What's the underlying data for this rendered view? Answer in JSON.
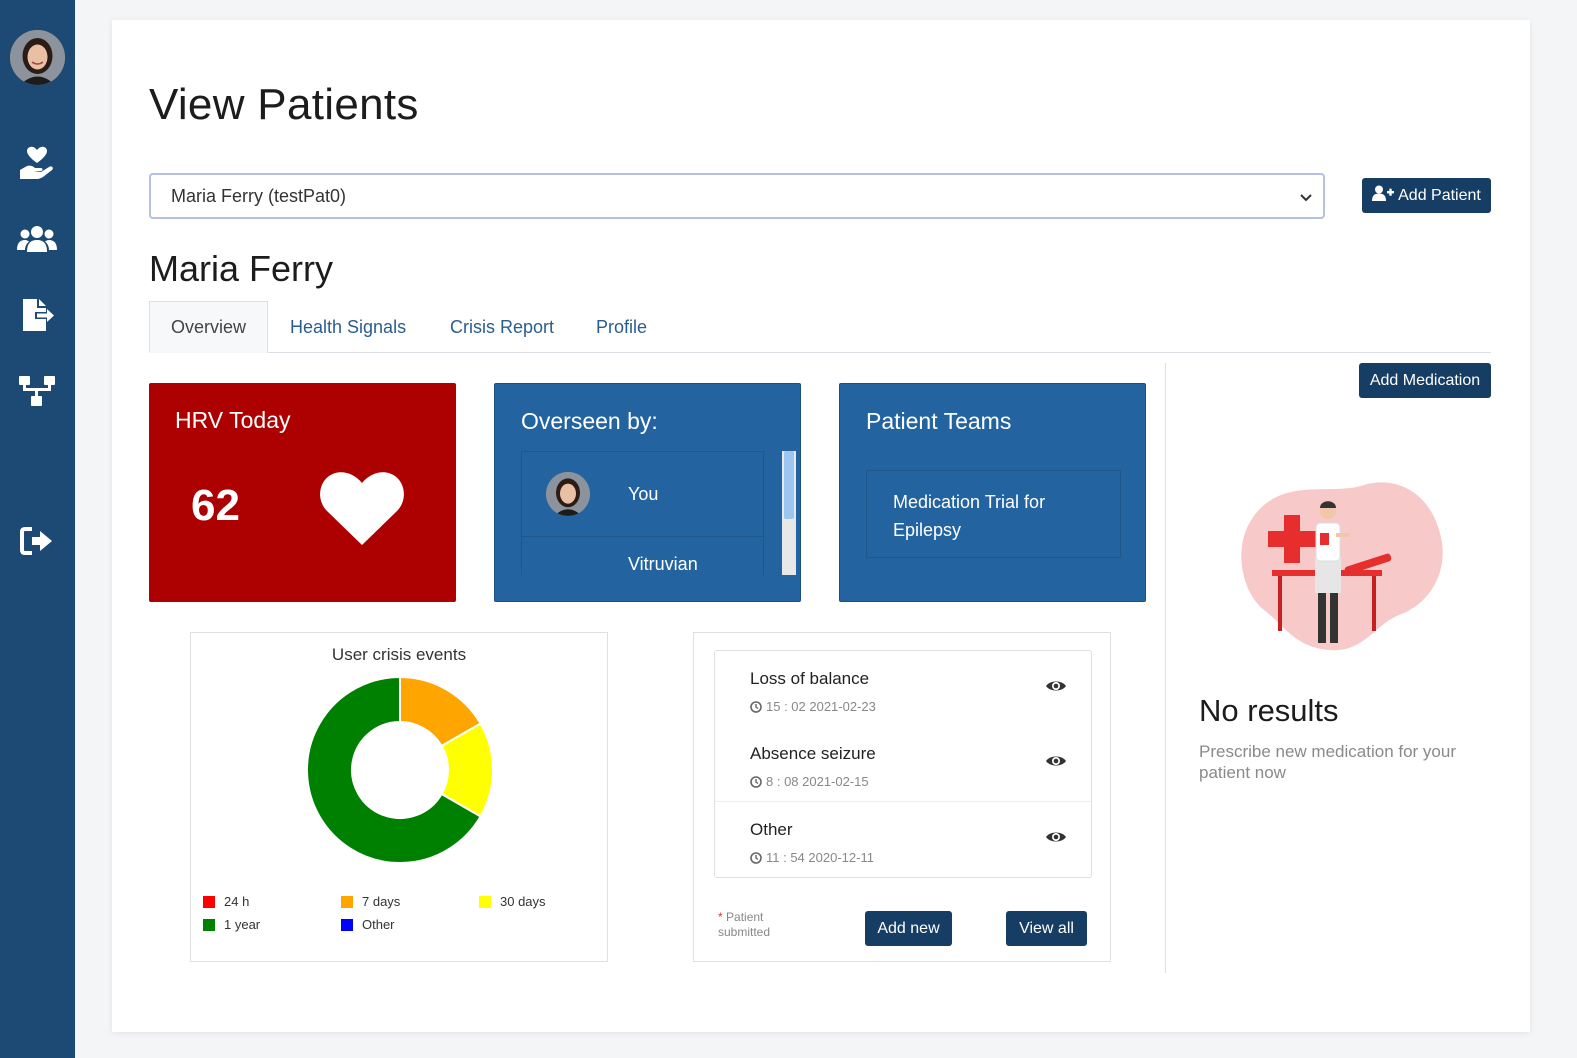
{
  "sidebar": {
    "items": [
      {
        "icon": "hand-heart-icon",
        "name": "care"
      },
      {
        "icon": "users-icon",
        "name": "teams"
      },
      {
        "icon": "file-export-icon",
        "name": "reports"
      },
      {
        "icon": "sitemap-icon",
        "name": "hierarchy"
      },
      {
        "icon": "sign-out-icon",
        "name": "logout"
      }
    ]
  },
  "page": {
    "title": "View Patients"
  },
  "patient_select": {
    "value": "Maria Ferry (testPat0)"
  },
  "add_patient_label": "Add Patient",
  "patient": {
    "name": "Maria Ferry"
  },
  "tabs": [
    {
      "label": "Overview",
      "active": true
    },
    {
      "label": "Health Signals",
      "active": false
    },
    {
      "label": "Crisis Report",
      "active": false
    },
    {
      "label": "Profile",
      "active": false
    }
  ],
  "hrv": {
    "title": "HRV Today",
    "value": "62"
  },
  "overseen": {
    "title": "Overseen by:",
    "people": [
      {
        "name": "You"
      },
      {
        "name": "Vitruvian"
      }
    ]
  },
  "teams": {
    "title": "Patient Teams",
    "items": [
      "Medication Trial for Epilepsy"
    ]
  },
  "chart_data": {
    "type": "pie",
    "title": "User crisis events",
    "categories": [
      "24 h",
      "7 days",
      "30 days",
      "1 year",
      "Other"
    ],
    "values": [
      0,
      1,
      1,
      4,
      0
    ],
    "colors": [
      "#ff0000",
      "#ffa500",
      "#ffff00",
      "#008000",
      "#0000ff"
    ],
    "legend": "bottom"
  },
  "crisis_events": [
    {
      "name": "Loss of balance",
      "time": "15 : 02 2021-02-23"
    },
    {
      "name": "Absence seizure",
      "time": "8 : 08 2021-02-15"
    },
    {
      "name": "Other",
      "time": "11 : 54 2020-12-11"
    }
  ],
  "crisis_note": {
    "star": "*",
    "text": "Patient submitted"
  },
  "add_new_label": "Add new",
  "view_all_label": "View all",
  "add_medication_label": "Add Medication",
  "medication": {
    "empty_title": "No results",
    "empty_subtitle": "Prescribe new medication for your patient now"
  },
  "colors": {
    "sidebar": "#1d4a75",
    "hrv_card": "#ad0000",
    "blue_card": "#2364a0",
    "button": "#163d63"
  }
}
